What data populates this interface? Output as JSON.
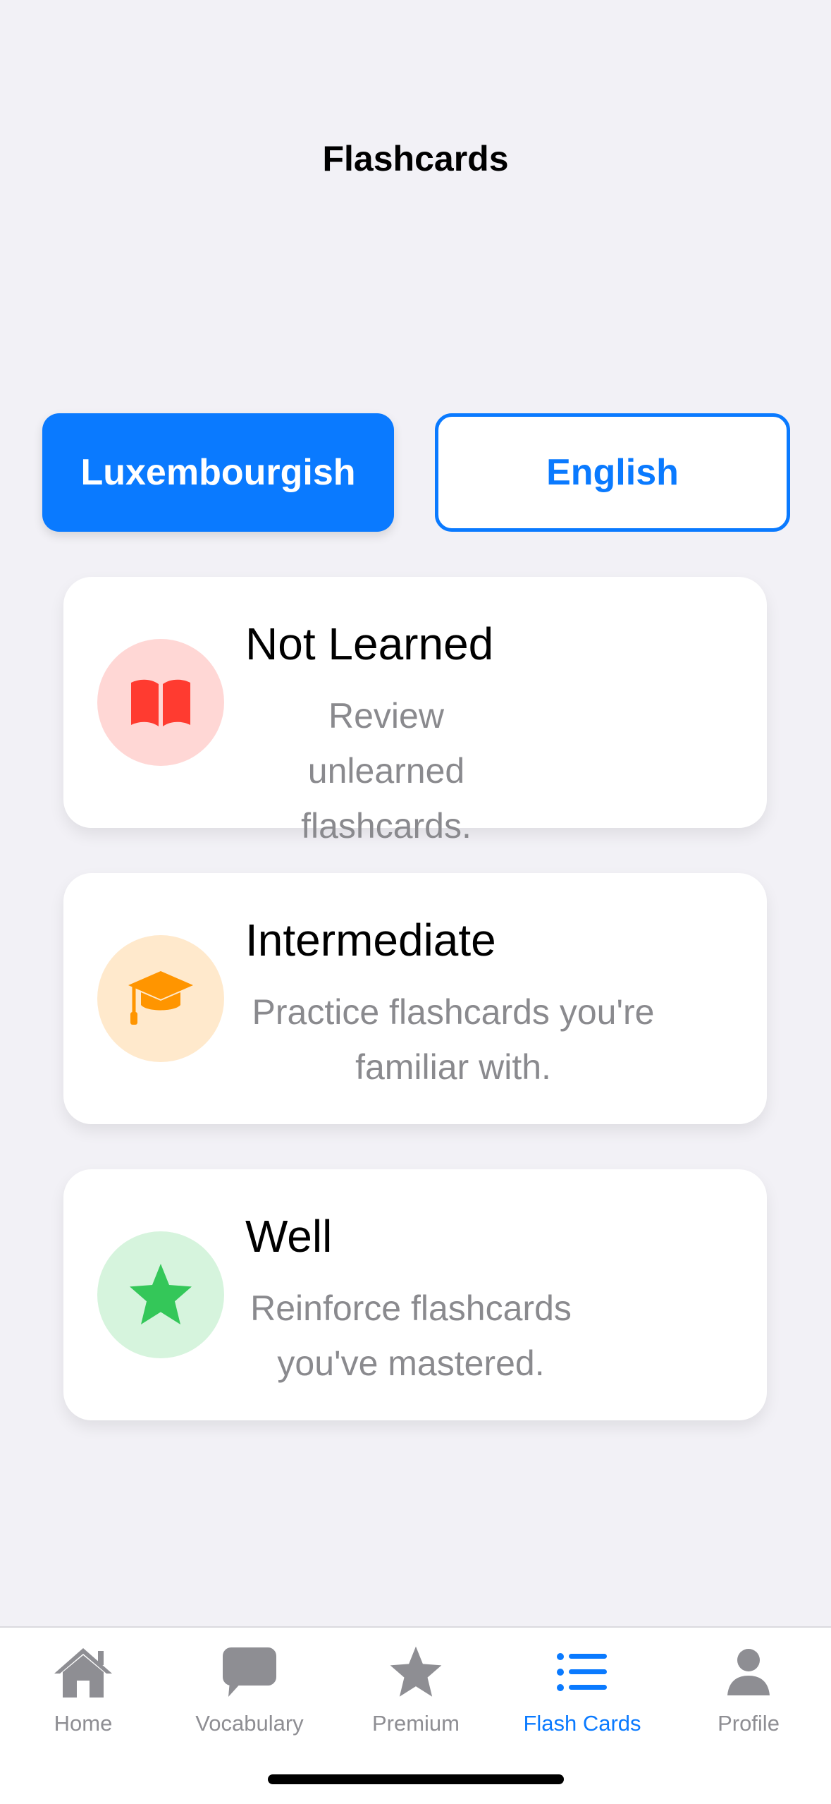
{
  "header": {
    "title": "Flashcards"
  },
  "language_toggle": {
    "left_label": "Luxembourgish",
    "right_label": "English",
    "selected": "Luxembourgish",
    "accent_color": "#0A7AFF"
  },
  "cards": [
    {
      "title": "Not Learned",
      "description_line1": "Review unlearned",
      "description_line2": "flashcards.",
      "icon": "book-icon",
      "icon_color": "#FF3B30",
      "icon_bg": "#FFD7D5"
    },
    {
      "title": "Intermediate",
      "description_line1": "Practice flashcards you're",
      "description_line2": "familiar with.",
      "icon": "graduation-cap-icon",
      "icon_color": "#FF9500",
      "icon_bg": "#FFE9CC"
    },
    {
      "title": "Well",
      "description_line1": "Reinforce flashcards",
      "description_line2": "you've mastered.",
      "icon": "star-icon",
      "icon_color": "#34C759",
      "icon_bg": "#D6F4DD"
    }
  ],
  "tabbar": {
    "items": [
      {
        "label": "Home",
        "icon": "house-icon"
      },
      {
        "label": "Vocabulary",
        "icon": "speech-bubble-icon"
      },
      {
        "label": "Premium",
        "icon": "star-icon"
      },
      {
        "label": "Flash Cards",
        "icon": "list-icon",
        "selected": true
      },
      {
        "label": "Profile",
        "icon": "person-icon"
      }
    ],
    "inactive_color": "#8E8E93",
    "active_color": "#0A7AFF"
  }
}
